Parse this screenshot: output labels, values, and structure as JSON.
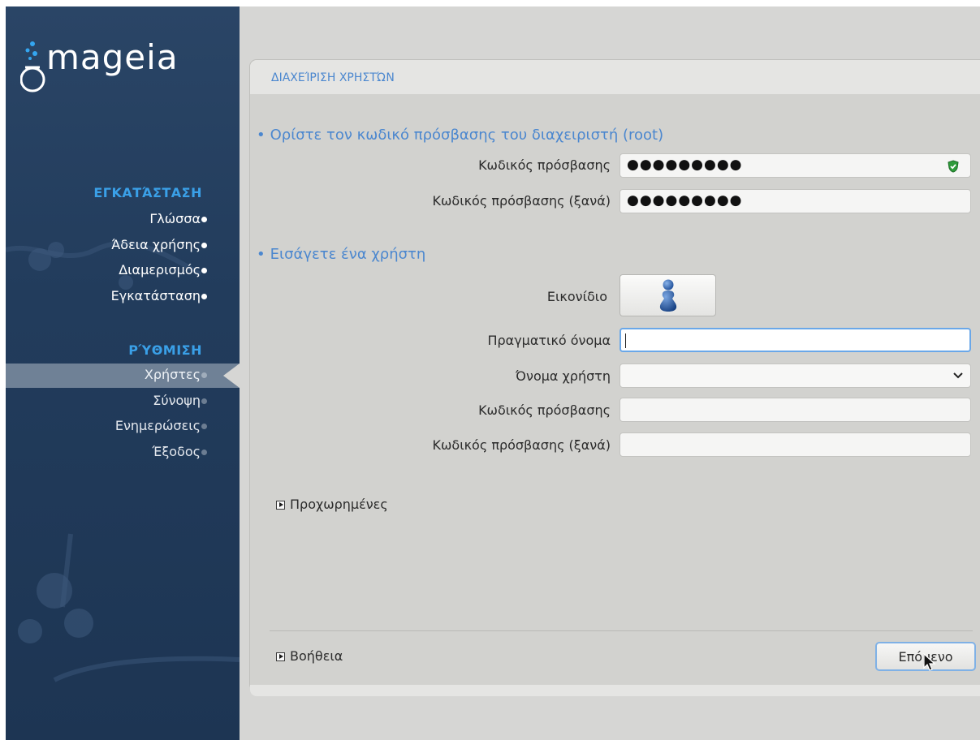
{
  "brand": {
    "logo_text": "mageia"
  },
  "sidebar": {
    "groups": [
      {
        "heading": "ΕΓΚΑΤΆΣΤΑΣΗ",
        "items": [
          {
            "label": "Γλώσσα"
          },
          {
            "label": "Άδεια χρήσης"
          },
          {
            "label": "Διαμερισμός"
          },
          {
            "label": "Εγκατάσταση"
          }
        ]
      },
      {
        "heading": "ΡΎΘΜΙΣΗ",
        "items": [
          {
            "label": "Χρήστες",
            "active": true
          },
          {
            "label": "Σύνοψη"
          },
          {
            "label": "Ενημερώσεις"
          },
          {
            "label": "Έξοδος"
          }
        ]
      }
    ]
  },
  "page": {
    "title": "ΔΙΑΧΕΊΡΙΣΗ ΧΡΗΣΤΏΝ",
    "root_section": {
      "heading": "Ορίστε τον κωδικό πρόσβασης του διαχειριστή (root)",
      "password_label": "Κωδικός πρόσβασης",
      "password_value": "●●●●●●●●●",
      "password_confirm_label": "Κωδικός πρόσβασης (ξανά)",
      "password_confirm_value": "●●●●●●●●●"
    },
    "user_section": {
      "heading": "Εισάγετε ένα χρήστη",
      "icon_label": "Εικονίδιο",
      "realname_label": "Πραγματικό όνομα",
      "realname_value": "",
      "username_label": "Όνομα χρήστη",
      "username_value": "",
      "password_label": "Κωδικός πρόσβασης",
      "password_value": "",
      "password_confirm_label": "Κωδικός πρόσβασης (ξανά)",
      "password_confirm_value": ""
    },
    "advanced_label": "Προχωρημένες",
    "help_label": "Βοήθεια",
    "next_label": "Επόμενο"
  },
  "colors": {
    "sidebar_bg": "#223c5c",
    "accent_blue": "#4b87cf",
    "heading_blue": "#3aa0e8",
    "strength_ok": "#2e9b3a"
  }
}
